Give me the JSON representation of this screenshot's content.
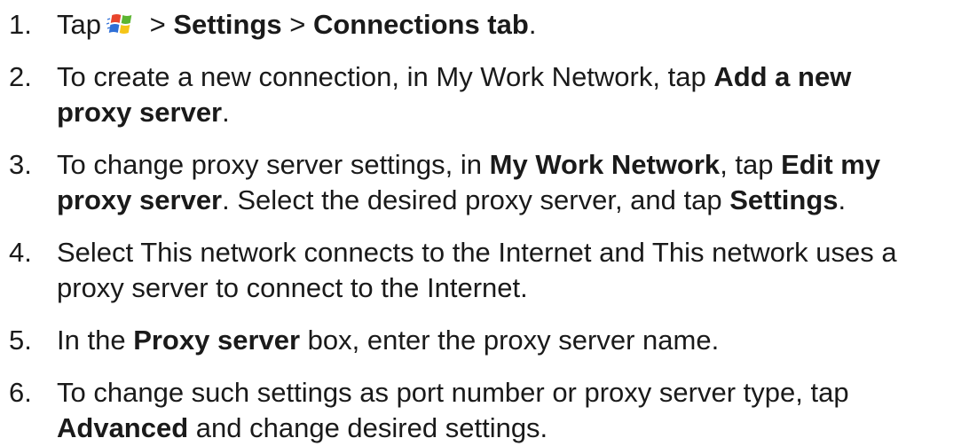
{
  "steps": [
    {
      "number": "1.",
      "t1": "Tap",
      "icon": "windows-start-icon",
      "t2": " > ",
      "b1": "Settings",
      "t3": " > ",
      "b2": "Connections tab",
      "t4": "."
    },
    {
      "number": "2.",
      "t1": "To create a new connection, in My Work Network, tap ",
      "b1": "Add a new",
      "b2": "proxy server",
      "t2": "."
    },
    {
      "number": "3.",
      "t1": "To change proxy server settings, in ",
      "b1": "My Work Network",
      "t2": ", tap ",
      "b2": "Edit my",
      "b3": "proxy server",
      "t3": ". Select the desired proxy server, and tap ",
      "b4": "Settings",
      "t4": "."
    },
    {
      "number": "4.",
      "t1": "Select This network connects to the Internet and This network uses a",
      "t2": "proxy server to connect to the Internet."
    },
    {
      "number": "5.",
      "t1": "In the ",
      "b1": "Proxy server",
      "t2": " box, enter the proxy server name."
    },
    {
      "number": "6.",
      "t1": "To change such settings as port number or proxy server type, tap",
      "b1": "Advanced",
      "t2": " and change desired settings."
    }
  ],
  "colors": {
    "text": "#1a1a1a",
    "icon_red": "#e8452c",
    "icon_green": "#5cb531",
    "icon_blue": "#2f6fd6",
    "icon_yellow": "#f5c518"
  }
}
